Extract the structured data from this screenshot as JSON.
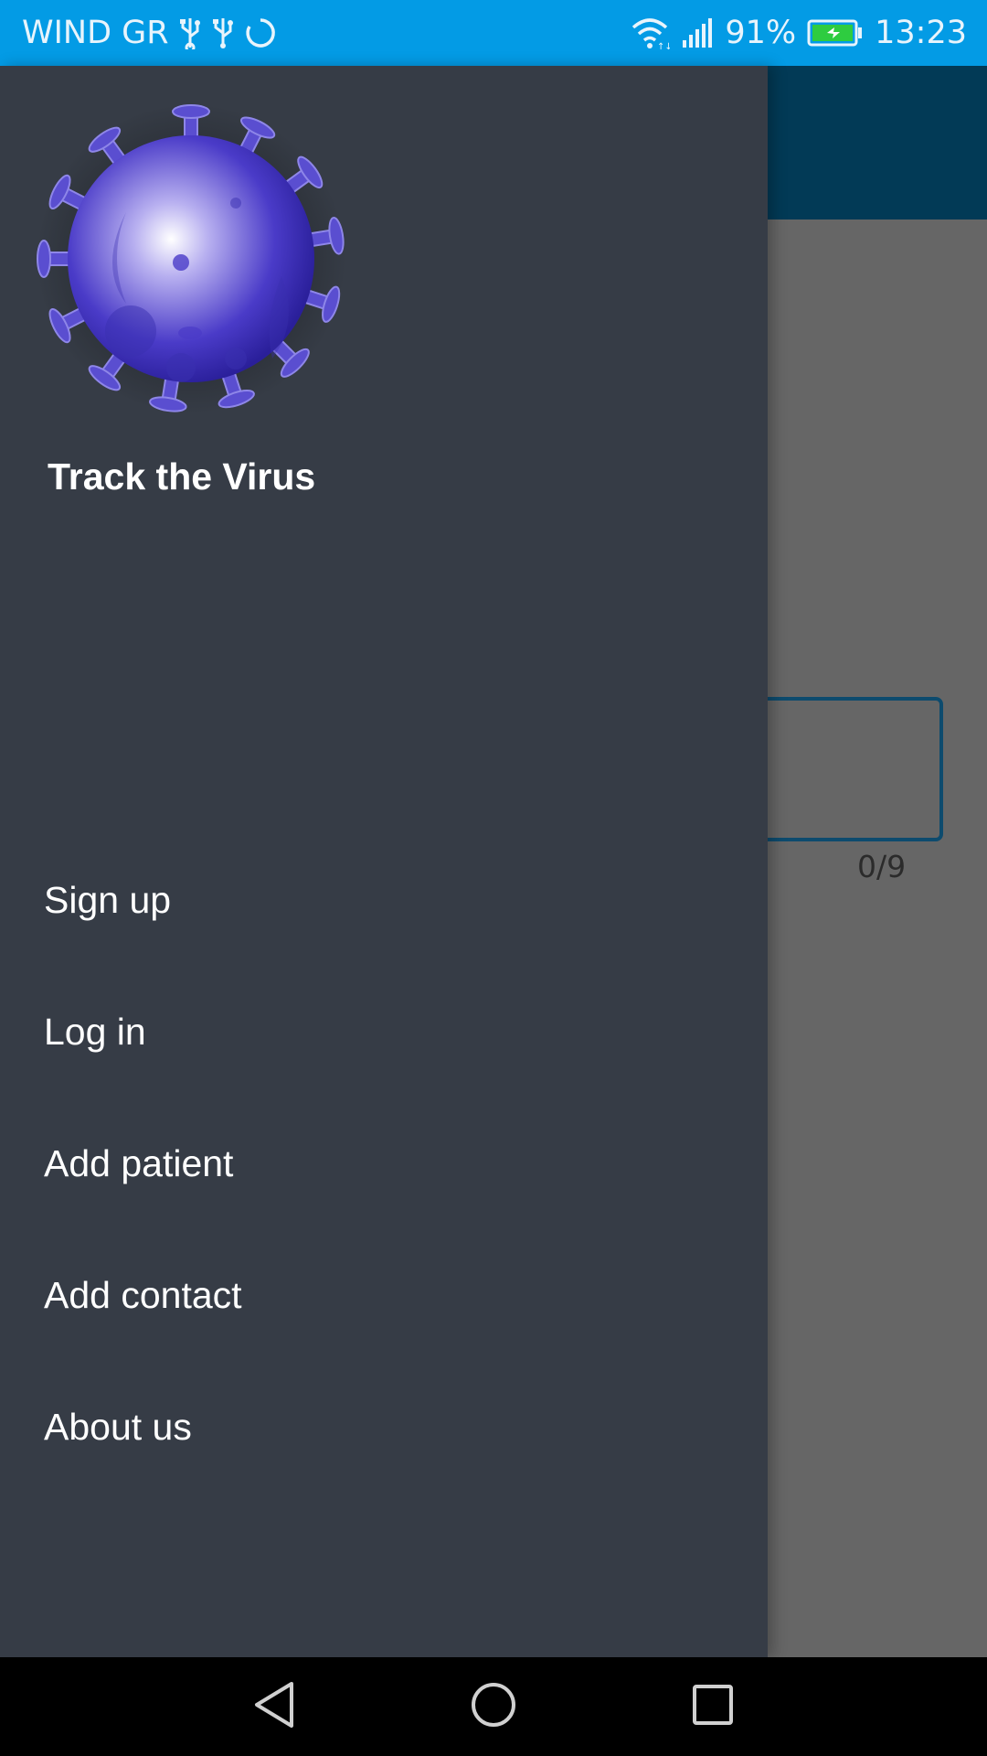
{
  "status_bar": {
    "carrier": "WIND GR",
    "battery_percent": "91%",
    "time": "13:23",
    "icons": [
      "usb-icon",
      "usb-icon",
      "sync-icon",
      "wifi-icon",
      "signal-icon",
      "battery-charging-icon"
    ]
  },
  "background_app": {
    "counter": "0/9",
    "toolbar_color": "#023A56"
  },
  "drawer": {
    "logo": "virus-logo-icon",
    "title": "Track the Virus",
    "items": [
      {
        "label": "Sign up"
      },
      {
        "label": "Log in"
      },
      {
        "label": "Add patient"
      },
      {
        "label": "Add contact"
      },
      {
        "label": "About us"
      }
    ],
    "background_color": "#363C46"
  },
  "nav_bar": {
    "buttons": [
      "back-icon",
      "home-icon",
      "recents-icon"
    ]
  }
}
